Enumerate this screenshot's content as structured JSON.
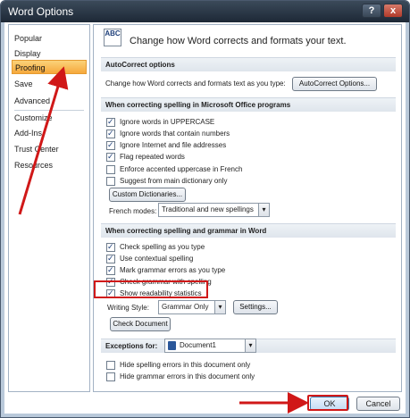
{
  "window": {
    "title": "Word Options",
    "help_icon": "?",
    "close_icon": "x"
  },
  "nav": {
    "items": [
      "Popular",
      "Display",
      "Proofing",
      "Save",
      "Advanced",
      "Customize",
      "Add-Ins",
      "Trust Center",
      "Resources"
    ],
    "selected": "Proofing"
  },
  "header": {
    "text": "Change how Word corrects and formats your text.",
    "icon_text": "ABC"
  },
  "autocorrect": {
    "section": "AutoCorrect options",
    "label": "Change how Word corrects and formats text as you type:",
    "button": "AutoCorrect Options..."
  },
  "spelling_office": {
    "section": "When correcting spelling in Microsoft Office programs",
    "options": [
      {
        "label": "Ignore words in UPPERCASE",
        "checked": true
      },
      {
        "label": "Ignore words that contain numbers",
        "checked": true
      },
      {
        "label": "Ignore Internet and file addresses",
        "checked": true
      },
      {
        "label": "Flag repeated words",
        "checked": true
      },
      {
        "label": "Enforce accented uppercase in French",
        "checked": false
      },
      {
        "label": "Suggest from main dictionary only",
        "checked": false
      }
    ],
    "custom_dictionaries_button": "Custom Dictionaries...",
    "french_modes_label": "French modes:",
    "french_modes_value": "Traditional and new spellings"
  },
  "spelling_word": {
    "section": "When correcting spelling and grammar in Word",
    "options": [
      {
        "label": "Check spelling as you type",
        "checked": true
      },
      {
        "label": "Use contextual spelling",
        "checked": true
      },
      {
        "label": "Mark grammar errors as you type",
        "checked": true
      },
      {
        "label": "Check grammar with spelling",
        "checked": true
      },
      {
        "label": "Show readability statistics",
        "checked": true
      }
    ],
    "writing_style_label": "Writing Style:",
    "writing_style_value": "Grammar Only",
    "settings_button": "Settings...",
    "check_document_button": "Check Document"
  },
  "exceptions": {
    "label": "Exceptions for:",
    "document": "Document1",
    "options": [
      {
        "label": "Hide spelling errors in this document only",
        "checked": false
      },
      {
        "label": "Hide grammar errors in this document only",
        "checked": false
      }
    ]
  },
  "footer": {
    "ok": "OK",
    "cancel": "Cancel"
  },
  "colors": {
    "annotation": "#d01818",
    "selected_nav": "#f6a83c"
  }
}
